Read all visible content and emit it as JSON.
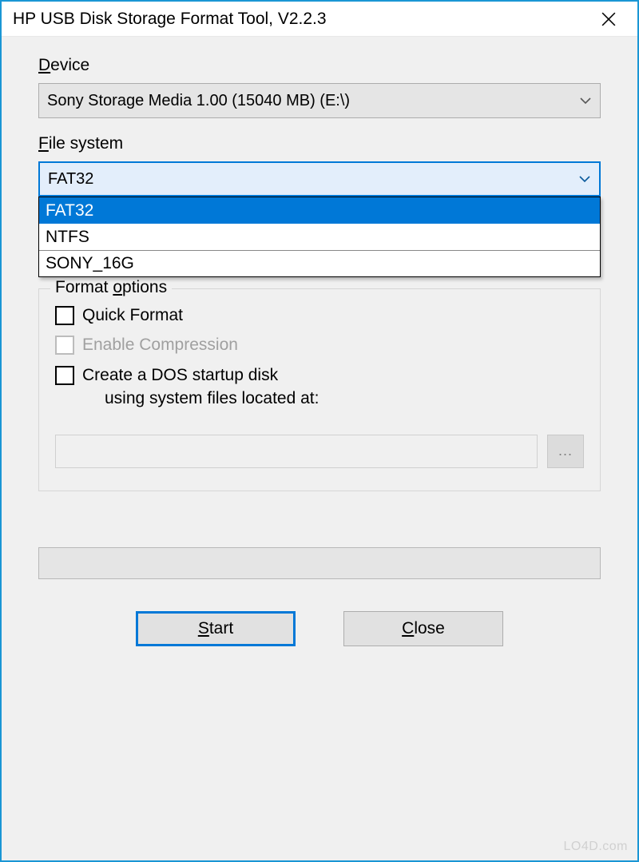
{
  "window": {
    "title": "HP USB Disk Storage Format Tool, V2.2.3"
  },
  "device": {
    "label": "Device",
    "selected": "Sony    Storage Media   1.00 (15040 MB) (E:\\)"
  },
  "filesystem": {
    "label": "File system",
    "selected": "FAT32",
    "options": [
      "FAT32",
      "NTFS",
      "SONY_16G"
    ]
  },
  "format_options": {
    "legend_prefix": "Format ",
    "legend_underlined": "o",
    "legend_suffix": "ptions",
    "quick_format": "Quick Format",
    "enable_compression": "Enable Compression",
    "dos_startup_line1": "Create a DOS startup disk",
    "dos_startup_line2": "using system files located at:",
    "browse_label": "..."
  },
  "buttons": {
    "start": "Start",
    "close": "Close"
  },
  "watermark": "LO4D.com"
}
